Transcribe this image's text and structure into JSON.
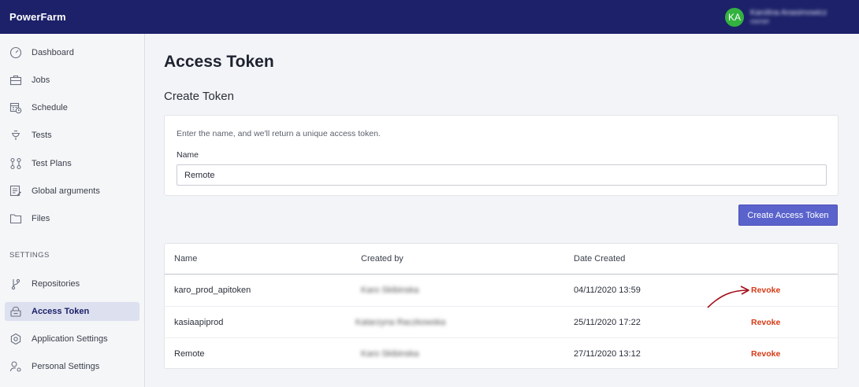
{
  "app": {
    "title": "PowerFarm"
  },
  "user": {
    "initials": "KA",
    "name": "Karolina Anasimowicz",
    "role": "owner"
  },
  "sidebar": {
    "items": [
      {
        "label": "Dashboard",
        "icon": "dashboard-icon"
      },
      {
        "label": "Jobs",
        "icon": "briefcase-icon"
      },
      {
        "label": "Schedule",
        "icon": "calendar-clock-icon"
      },
      {
        "label": "Tests",
        "icon": "flask-icon"
      },
      {
        "label": "Test Plans",
        "icon": "flow-icon"
      },
      {
        "label": "Global arguments",
        "icon": "edit-list-icon"
      },
      {
        "label": "Files",
        "icon": "folder-icon"
      }
    ],
    "settings_label": "SETTINGS",
    "settings_items": [
      {
        "label": "Repositories",
        "icon": "branch-icon"
      },
      {
        "label": "Access Token",
        "icon": "lock-icon",
        "active": true
      },
      {
        "label": "Application Settings",
        "icon": "gear-icon"
      },
      {
        "label": "Personal Settings",
        "icon": "user-settings-icon"
      }
    ]
  },
  "page": {
    "title": "Access Token",
    "create_title": "Create Token",
    "hint": "Enter the name, and we'll return a unique access token.",
    "name_label": "Name",
    "name_value": "Remote",
    "create_button": "Create Access Token"
  },
  "tokens": {
    "headers": {
      "name": "Name",
      "created_by": "Created by",
      "date_created": "Date Created"
    },
    "rows": [
      {
        "name": "karo_prod_apitoken",
        "created_by": "Karo Skibinska",
        "date_created": "04/11/2020 13:59",
        "action": "Revoke"
      },
      {
        "name": "kasiaapiprod",
        "created_by": "Katarzyna Raczkowska",
        "date_created": "25/11/2020 17:22",
        "action": "Revoke"
      },
      {
        "name": "Remote",
        "created_by": "Karo Skibinska",
        "date_created": "27/11/2020 13:12",
        "action": "Revoke"
      }
    ]
  },
  "colors": {
    "topbar": "#1c2169",
    "accent": "#5a63cc",
    "revoke": "#d63a16",
    "avatar": "#33b240",
    "annotation_arrow": "#a3101a"
  }
}
